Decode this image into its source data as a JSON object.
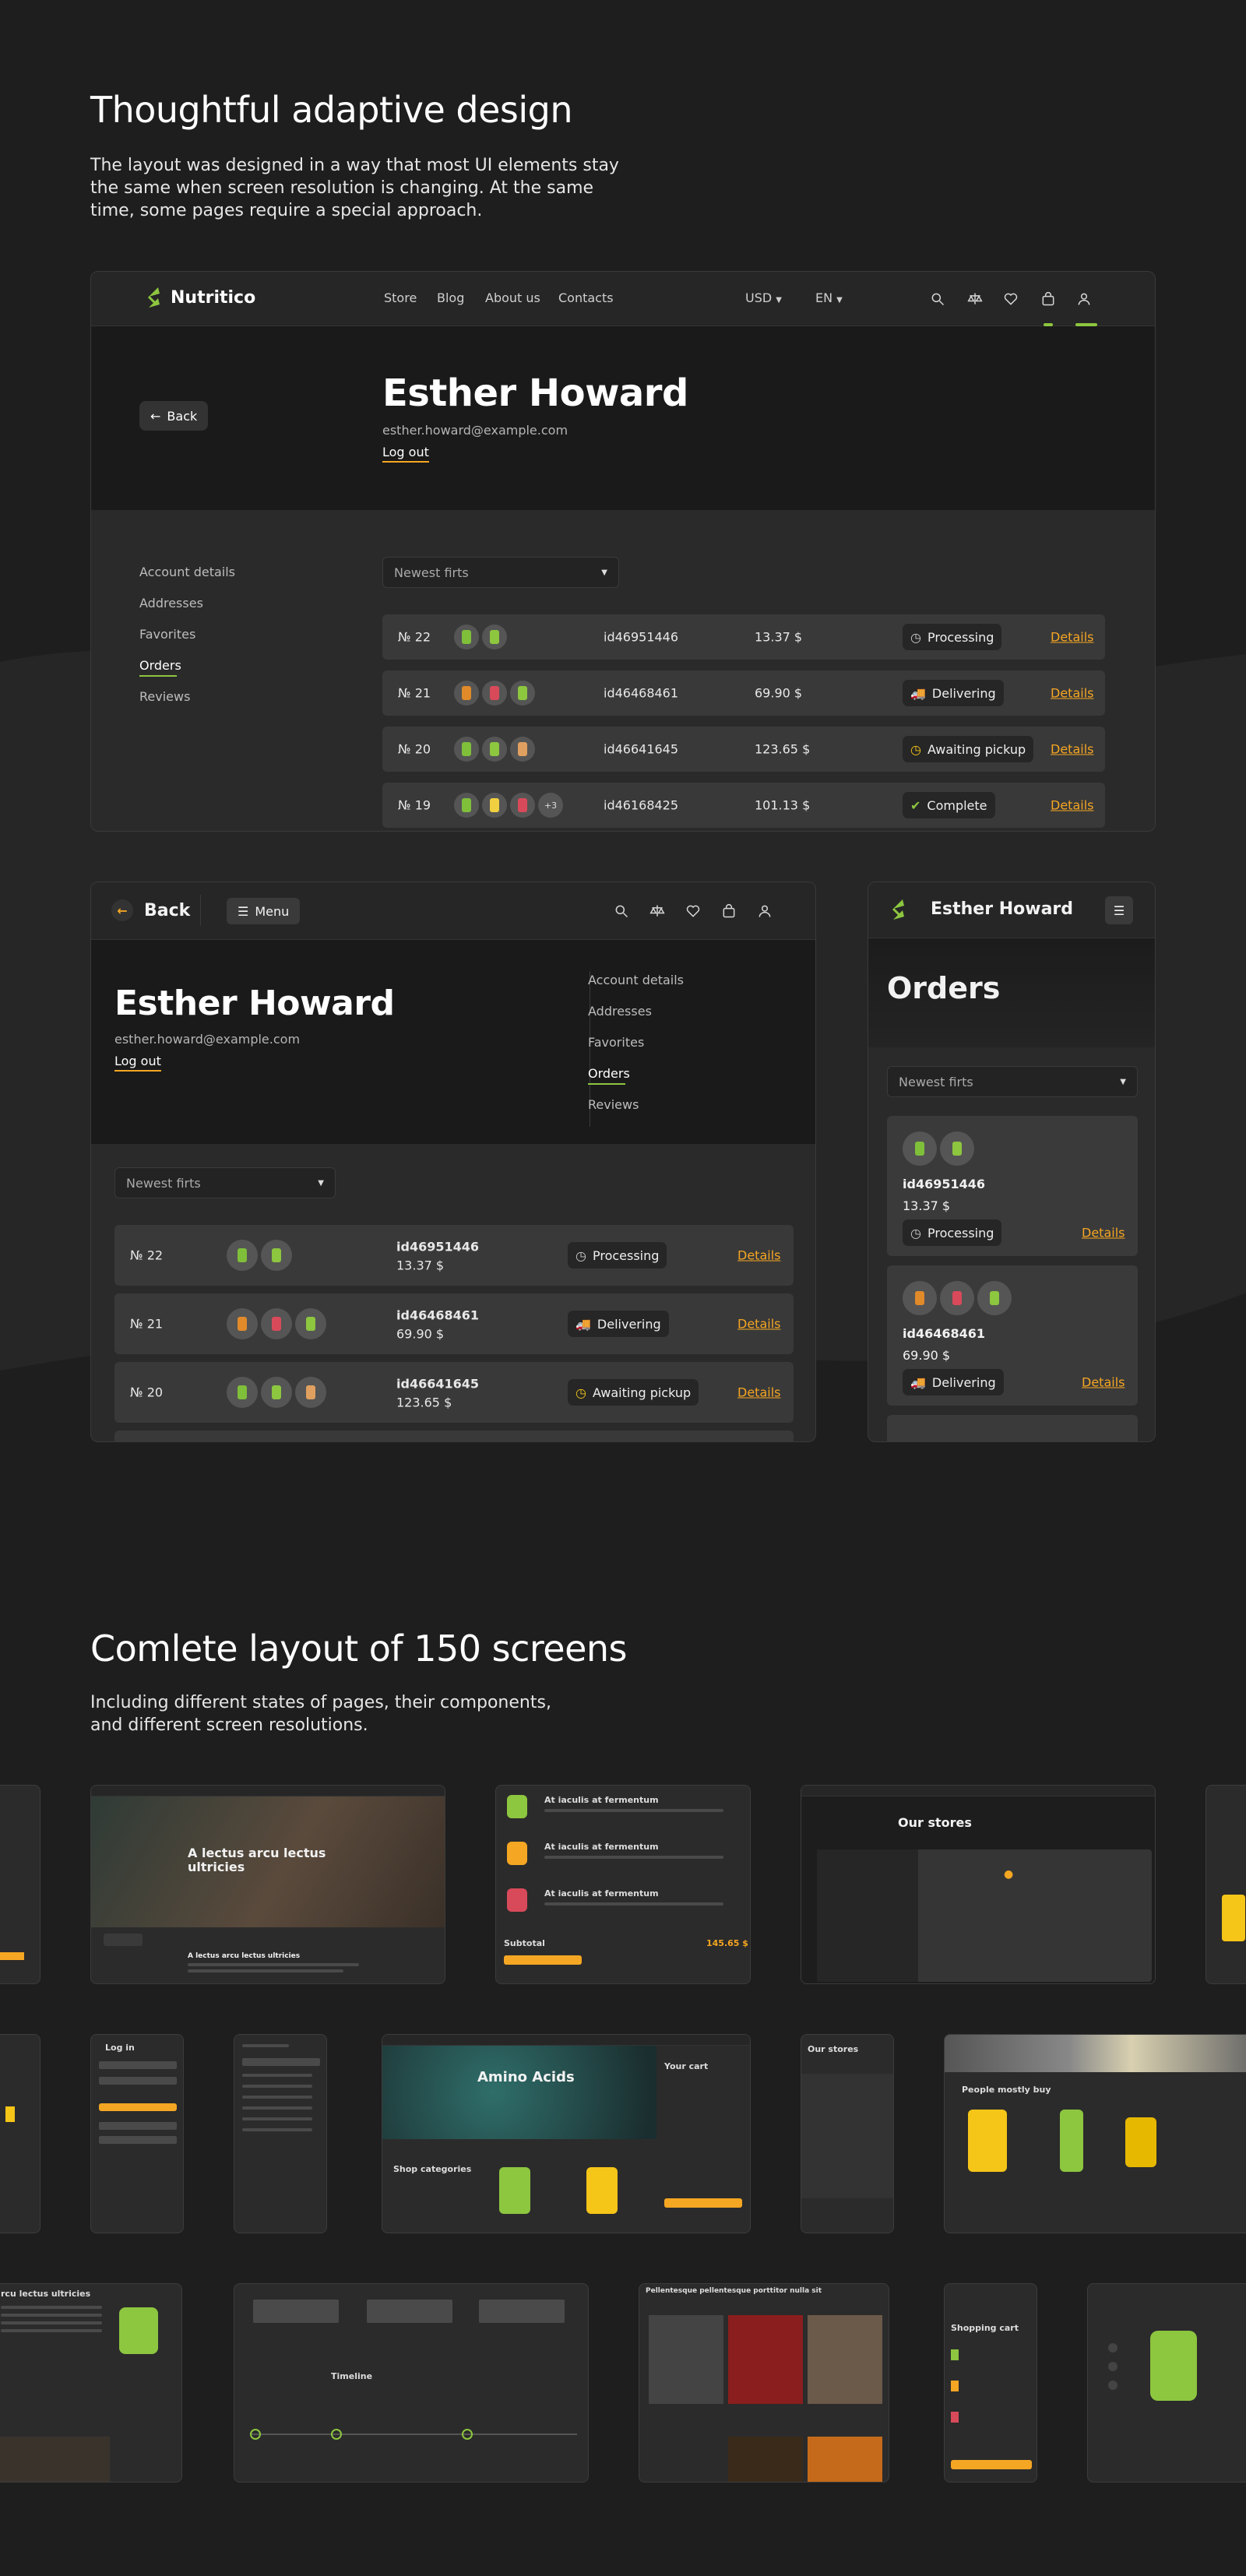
{
  "section1": {
    "title": "Thoughtful adaptive design",
    "description": "The layout was designed in a way that most UI elements stay the same when screen resolution is changing. At the same time, some pages require a special approach."
  },
  "desktop": {
    "brand": "Nutritico",
    "nav": [
      "Store",
      "Blog",
      "About us",
      "Contacts"
    ],
    "currency": "USD",
    "language": "EN",
    "back_label": "Back",
    "user_name": "Esther Howard",
    "user_email": "esther.howard@example.com",
    "logout_label": "Log out",
    "sidebar": [
      "Account details",
      "Addresses",
      "Favorites",
      "Orders",
      "Reviews"
    ],
    "sort_selected": "Newest firts",
    "orders": [
      {
        "no": "№ 22",
        "id": "id46951446",
        "price": "13.37 $",
        "status": "Processing",
        "link": "Details"
      },
      {
        "no": "№ 21",
        "id": "id46468461",
        "price": "69.90 $",
        "status": "Delivering",
        "link": "Details"
      },
      {
        "no": "№ 20",
        "id": "id46641645",
        "price": "123.65 $",
        "status": "Awaiting pickup",
        "link": "Details"
      },
      {
        "no": "№ 19",
        "id": "id46168425",
        "price": "101.13 $",
        "status": "Complete",
        "link": "Details",
        "extra": "+3"
      }
    ]
  },
  "tablet": {
    "back_label": "Back",
    "menu_label": "Menu",
    "user_name": "Esther Howard",
    "user_email": "esther.howard@example.com",
    "logout_label": "Log out",
    "sidebar": [
      "Account details",
      "Addresses",
      "Favorites",
      "Orders",
      "Reviews"
    ],
    "sort_selected": "Newest firts",
    "orders": [
      {
        "no": "№ 22",
        "id": "id46951446",
        "price": "13.37 $",
        "status": "Processing",
        "link": "Details"
      },
      {
        "no": "№ 21",
        "id": "id46468461",
        "price": "69.90 $",
        "status": "Delivering",
        "link": "Details"
      },
      {
        "no": "№ 20",
        "id": "id46641645",
        "price": "123.65 $",
        "status": "Awaiting pickup",
        "link": "Details"
      }
    ]
  },
  "mobile": {
    "user_name": "Esther Howard",
    "page_title": "Orders",
    "sort_selected": "Newest firts",
    "orders": [
      {
        "id": "id46951446",
        "price": "13.37 $",
        "status": "Processing",
        "link": "Details"
      },
      {
        "id": "id46468461",
        "price": "69.90 $",
        "status": "Delivering",
        "link": "Details"
      }
    ]
  },
  "section2": {
    "title": "Comlete layout of 150 screens",
    "description": "Including different states of pages, their components, and different screen resolutions."
  },
  "gallery": {
    "hero_title": "A lectus arcu lectus ultricies",
    "hero_caption": "A lectus arcu lectus ultricies",
    "cart_item": "At iaculis at fermentum",
    "cart_subtotal": "Subtotal",
    "cart_total": "145.65 $",
    "stores_title": "Our stores",
    "login_title": "Log in",
    "category_title": "Amino Acids",
    "shop_categories": "Shop categories",
    "your_cart": "Your cart",
    "people_buy": "People mostly buy",
    "article_title": "rcu lectus ultricies",
    "timeline": "Timeline",
    "gallery_title": "Pellentesque pellentesque porttitor nulla sit",
    "shopping_cart": "Shopping cart"
  },
  "colors": {
    "accent": "#f5a623",
    "brand_green": "#8dc63f",
    "background": "#1e1e1e"
  }
}
